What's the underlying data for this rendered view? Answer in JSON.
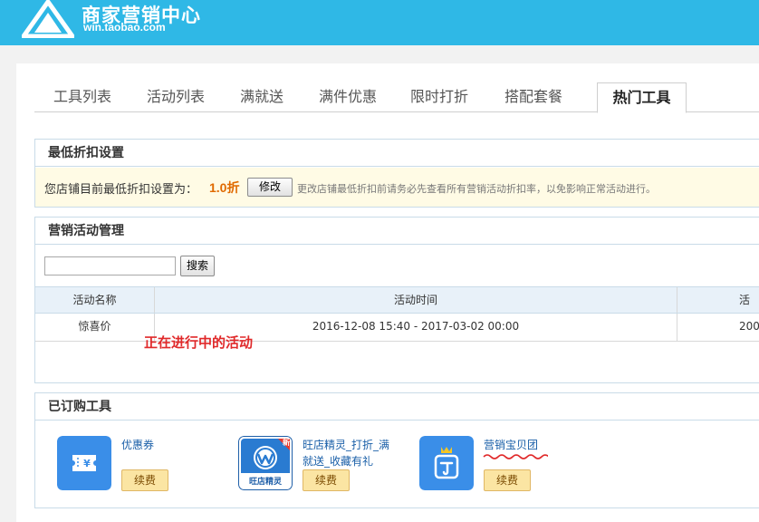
{
  "header": {
    "title": "商家营销中心",
    "subtitle": "win.taobao.com"
  },
  "tabs": [
    {
      "label": "工具列表"
    },
    {
      "label": "活动列表"
    },
    {
      "label": "满就送"
    },
    {
      "label": "满件优惠"
    },
    {
      "label": "限时打折"
    },
    {
      "label": "搭配套餐"
    },
    {
      "label": "热门工具",
      "active": true
    }
  ],
  "discount": {
    "heading": "最低折扣设置",
    "label": "您店铺目前最低折扣设置为：",
    "value": "1.0折",
    "edit_label": "修改",
    "tip": "更改店铺最低折扣前请务必先查看所有营销活动折扣率，以免影响正常活动进行。"
  },
  "activities": {
    "heading": "营销活动管理",
    "search_label": "搜索",
    "search_value": "",
    "columns": [
      "活动名称",
      "活动时间",
      "活"
    ],
    "rows": [
      {
        "name": "惊喜价",
        "time": "2016-12-08 15:40 - 2017-03-02 00:00",
        "extra": "200"
      }
    ],
    "annotation": "正在进行中的活动"
  },
  "purchased": {
    "heading": "已订购工具",
    "tools": [
      {
        "name": "优惠券",
        "renew": "续费",
        "icon": "coupon-icon"
      },
      {
        "name": "旺店精灵_打折_满就送_收藏有礼",
        "name_line1": "旺店精灵_打折_满",
        "name_line2": "就送_收藏有礼",
        "renew": "续费",
        "icon": "wangdian-jingling-icon",
        "badge": "新",
        "icon_caption": "旺店精灵"
      },
      {
        "name": "营销宝贝团",
        "renew": "续费",
        "icon": "marketing-group-icon"
      }
    ]
  },
  "colors": {
    "header_bg": "#2fb8e6",
    "accent_orange": "#e06a00",
    "annotation_red": "#e0292a",
    "link_blue": "#1a5fa8",
    "tool_icon_blue": "#3a8ee8"
  }
}
